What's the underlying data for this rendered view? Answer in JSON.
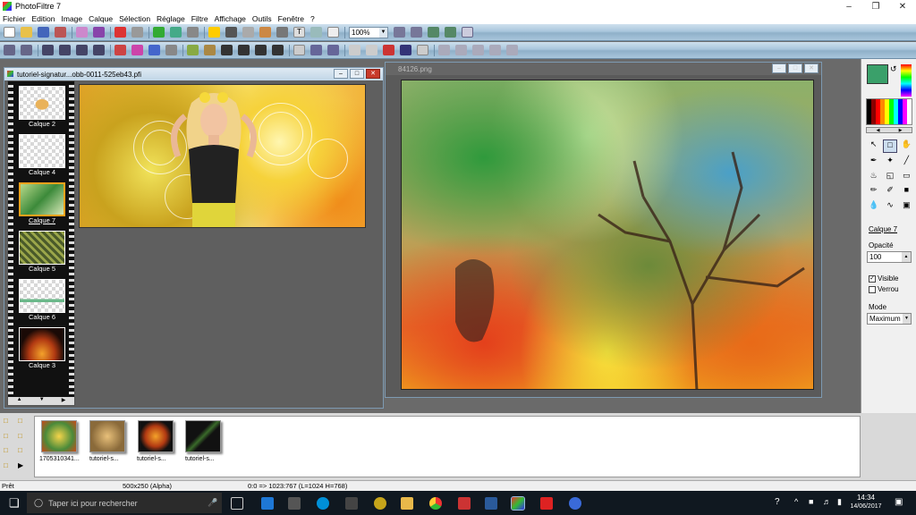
{
  "window": {
    "title": "PhotoFiltre 7"
  },
  "menu": [
    "Fichier",
    "Edition",
    "Image",
    "Calque",
    "Sélection",
    "Réglage",
    "Filtre",
    "Affichage",
    "Outils",
    "Fenêtre",
    "?"
  ],
  "toolbar": {
    "zoom_value": "100%"
  },
  "doc_left": {
    "title": "tutoriel-signatur...obb-0011-525eb43.pfi"
  },
  "doc_right": {
    "title": "84126.png"
  },
  "layers": [
    {
      "label": "Calque 2"
    },
    {
      "label": "Calque 4"
    },
    {
      "label": "Calque 7",
      "selected": true
    },
    {
      "label": "Calque 5"
    },
    {
      "label": "Calque 6"
    },
    {
      "label": "Calque 3"
    }
  ],
  "right_panel": {
    "layer_name": "Calque 7",
    "opacity_label": "Opacité",
    "opacity_value": "100",
    "visible_label": "Visible",
    "visible_checked": true,
    "lock_label": "Verrou",
    "lock_checked": false,
    "mode_label": "Mode",
    "mode_value": "Maximum"
  },
  "thumbnails": [
    {
      "label": "1705310341..."
    },
    {
      "label": "tutoriel-s..."
    },
    {
      "label": "tutoriel-s..."
    },
    {
      "label": "tutoriel-s..."
    }
  ],
  "status": {
    "ready": "Prêt",
    "size": "500x250 (Alpha)",
    "coords": "0:0 => 1023:767 (L=1024  H=768)"
  },
  "taskbar": {
    "search_placeholder": "Taper ici pour rechercher",
    "time": "14:34",
    "date": "14/06/2017"
  },
  "colors": {
    "primary": "#3aa06a",
    "secondary": "#ffffff",
    "accent": "#f4a21b",
    "title_close": "#c83a2a"
  }
}
